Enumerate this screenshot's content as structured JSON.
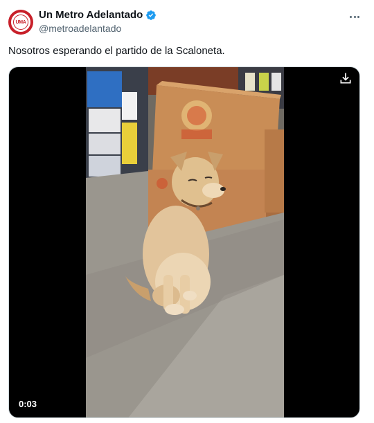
{
  "author": {
    "display_name": "Un Metro Adelantado",
    "handle": "@metroadelantado",
    "verified": true,
    "avatar_text": "UMA",
    "avatar_color": "#c8202a"
  },
  "tweet": {
    "text": "Nosotros esperando el partido de la Scaloneta."
  },
  "media": {
    "type": "video",
    "time": "0:03",
    "download_icon": "download-icon"
  },
  "menu": {
    "icon": "more-icon"
  },
  "colors": {
    "verified_blue": "#1d9bf0",
    "secondary_text": "#536471"
  }
}
